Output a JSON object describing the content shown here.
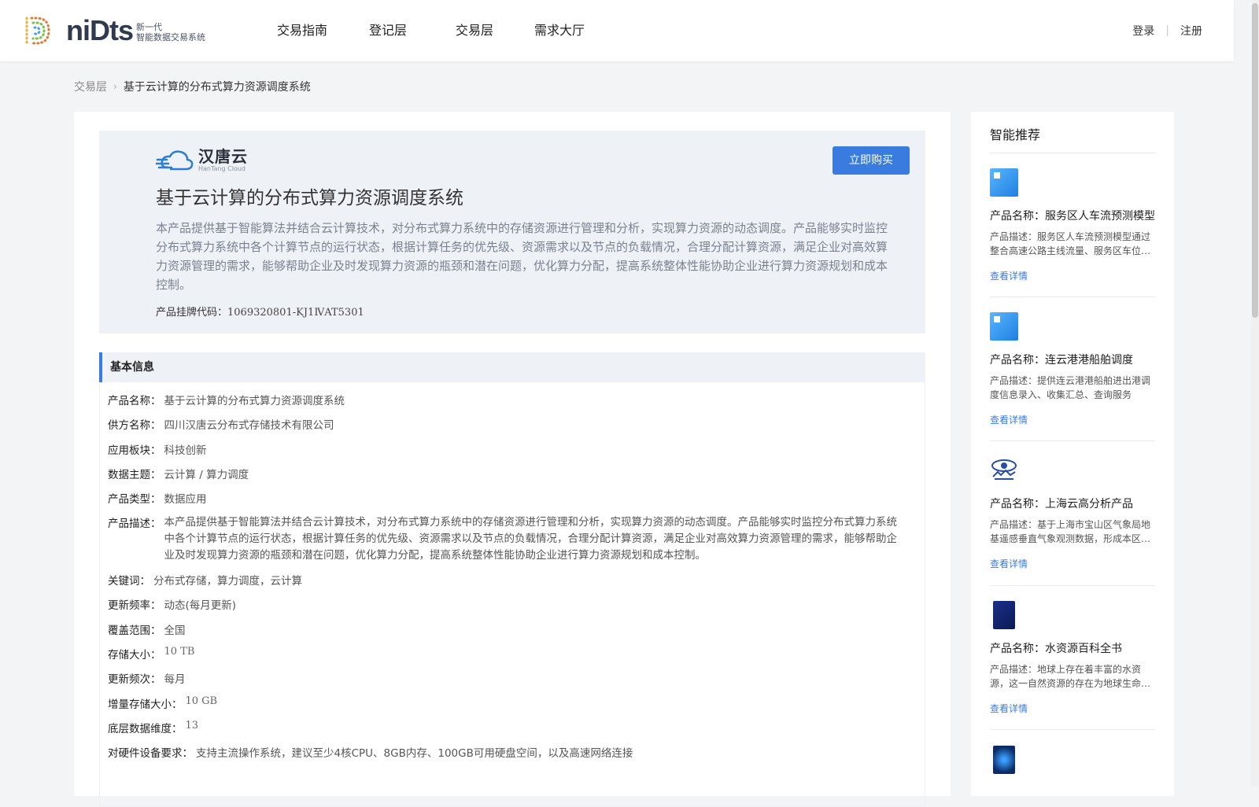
{
  "header": {
    "logo_word": "niDts",
    "logo_sub_1": "新一代",
    "logo_sub_2": "智能数据交易系统",
    "nav": [
      "交易指南",
      "登记层",
      "交易层",
      "需求大厅"
    ],
    "login": "登录",
    "register": "注册"
  },
  "breadcrumb": {
    "parent": "交易层",
    "current": "基于云计算的分布式算力资源调度系统"
  },
  "hero": {
    "brand_cn": "汉唐云",
    "brand_en": "HanTang Cloud",
    "buy_label": "立即购买",
    "title": "基于云计算的分布式算力资源调度系统",
    "description": "本产品提供基于智能算法并结合云计算技术，对分布式算力系统中的存储资源进行管理和分析，实现算力资源的动态调度。产品能够实时监控分布式算力系统中各个计算节点的运行状态，根据计算任务的优先级、资源需求以及节点的负载情况，合理分配计算资源，满足企业对高效算力资源管理的需求，能够帮助企业及时发现算力资源的瓶颈和潜在问题，优化算力分配，提高系统整体性能协助企业进行算力资源规划和成本控制。",
    "code_label": "产品挂牌代码：",
    "code_value": "1069320801-KJ1ⅣAT5301"
  },
  "info": {
    "section_title": "基本信息",
    "rows": [
      {
        "label": "产品名称：",
        "value": "基于云计算的分布式算力资源调度系统"
      },
      {
        "label": "供方名称：",
        "value": "四川汉唐云分布式存储技术有限公司"
      },
      {
        "label": "应用板块：",
        "value": "科技创新"
      },
      {
        "label": "数据主题：",
        "value": "云计算 / 算力调度"
      },
      {
        "label": "产品类型：",
        "value": "数据应用"
      },
      {
        "label": "产品描述：",
        "value": "本产品提供基于智能算法并结合云计算技术，对分布式算力系统中的存储资源进行管理和分析，实现算力资源的动态调度。产品能够实时监控分布式算力系统中各个计算节点的运行状态，根据计算任务的优先级、资源需求以及节点的负载情况，合理分配计算资源，满足企业对高效算力资源管理的需求，能够帮助企业及时发现算力资源的瓶颈和潜在问题，优化算力分配，提高系统整体性能协助企业进行算力资源规划和成本控制。"
      },
      {
        "label": "关键词：",
        "value": "分布式存储，算力调度，云计算"
      },
      {
        "label": "更新频率：",
        "value": "动态(每月更新)"
      },
      {
        "label": "覆盖范围：",
        "value": "全国"
      },
      {
        "label": "存储大小：",
        "value": "10 TB"
      },
      {
        "label": "更新频次：",
        "value": "每月"
      },
      {
        "label": "增量存储大小：",
        "value": "10 GB"
      },
      {
        "label": "底层数据维度：",
        "value": "13"
      },
      {
        "label": "对硬件设备要求：",
        "value": "支持主流操作系统，建议至少4核CPU、8GB内存、100GB可用硬盘空间，以及高速网络连接"
      }
    ]
  },
  "sidebar": {
    "title": "智能推荐",
    "items": [
      {
        "name": "产品名称：服务区人车流预测模型",
        "desc": "产品描述：服务区人车流预测模型通过整合高速公路主线流量、服务区车位…",
        "more": "查看详情"
      },
      {
        "name": "产品名称：连云港港船舶调度",
        "desc": "产品描述：提供连云港港船舶进出港调度信息录入、收集汇总、查询服务",
        "more": "查看详情"
      },
      {
        "name": "产品名称：上海云高分析产品",
        "desc": "产品描述：基于上海市宝山区气象局地基遥感垂直气象观测数据，形成本区…",
        "more": "查看详情"
      },
      {
        "name": "产品名称：水资源百科全书",
        "desc": "产品描述：地球上存在着丰富的水资源，这一自然资源的存在为地球生命…",
        "more": "查看详情"
      }
    ]
  }
}
